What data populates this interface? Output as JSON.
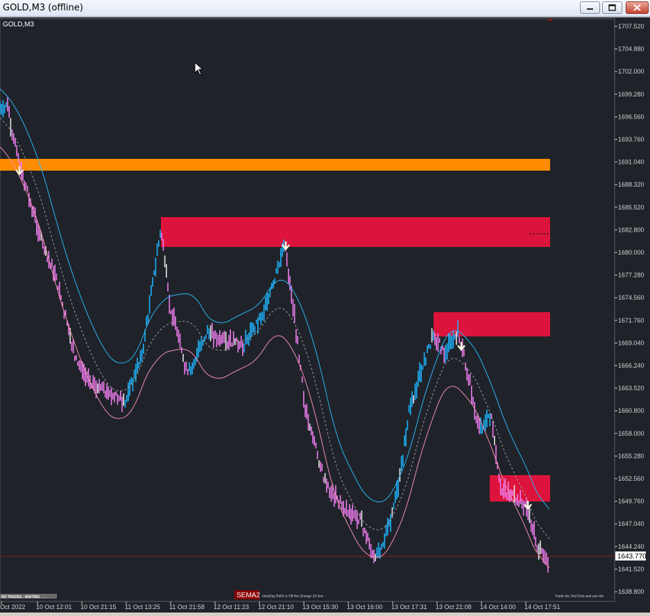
{
  "window": {
    "title": "GOLD,M3 (offline)",
    "minimize_icon": "minimize-icon",
    "maximize_icon": "maximize-icon",
    "close_icon": "close-icon"
  },
  "chart": {
    "symbol_label": "GOLD,M3",
    "current_price": "1643.770",
    "price_labels": [
      "1707.520",
      "1704.880",
      "1702.000",
      "1699.280",
      "1696.560",
      "1693.760",
      "1691.040",
      "1688.320",
      "1685.520",
      "1682.800",
      "1680.000",
      "1677.280",
      "1674.560",
      "1671.760",
      "1669.040",
      "1666.240",
      "1663.520",
      "1660.800",
      "1658.000",
      "1655.280",
      "1652.560",
      "1649.760",
      "1647.040",
      "1644.240",
      "1641.520",
      "1638.800"
    ],
    "time_labels": [
      "Oct 2022",
      "10 Oct 12:01",
      "10 Oct 21:15",
      "11 Oct 13:25",
      "11 Oct 21:58",
      "12 Oct 11:23",
      "12 Oct 21:10",
      "13 Oct 15:30",
      "13 Oct 16:00",
      "13 Oct 17:31",
      "13 Oct 21:08",
      "14 Oct 14:00",
      "14 Oct 17:51"
    ],
    "status_left": "NO TRADES - WAITING . . .",
    "sema_label": "SEMA2",
    "bias_text": "IntraDay BIAS is Off the Orange ZZ line -",
    "hint_text": "Trade the 2nd Dots and use the",
    "colors": {
      "background": "#1f2329",
      "orange_zone": "#ff8c00",
      "red_zone": "#dc143c",
      "bull_candle": "#1eb4ff",
      "bear_candle": "#f07cf0",
      "cursor": "#ffffff"
    },
    "icons": {
      "arrow": "arrow-down-icon",
      "cursor": "mouse-cursor-icon"
    }
  }
}
